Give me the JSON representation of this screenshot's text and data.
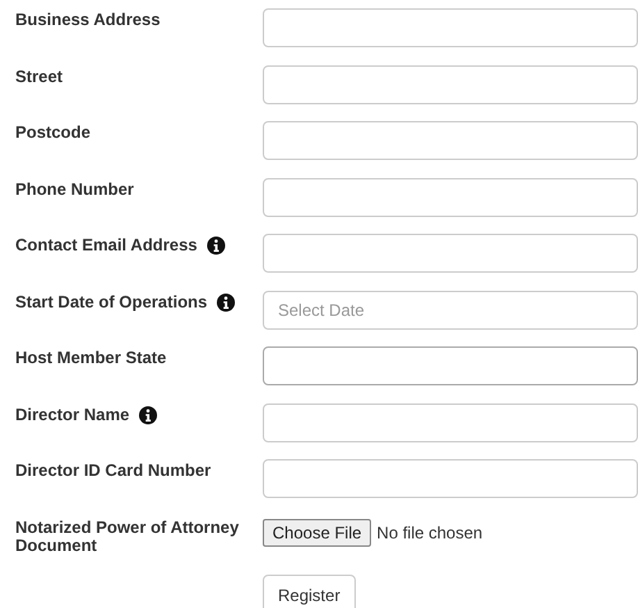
{
  "fields": [
    {
      "label": "Business Address",
      "kind": "text",
      "info": false
    },
    {
      "label": "Street",
      "kind": "text",
      "info": false
    },
    {
      "label": "Postcode",
      "kind": "text",
      "info": false
    },
    {
      "label": "Phone Number",
      "kind": "text",
      "info": false
    },
    {
      "label": "Contact Email Address",
      "kind": "text",
      "info": true
    },
    {
      "label": "Start Date of Operations",
      "kind": "date",
      "info": true,
      "placeholder": "Select Date"
    },
    {
      "label": "Host Member State",
      "kind": "select",
      "info": false
    },
    {
      "label": "Director Name",
      "kind": "text",
      "info": true
    },
    {
      "label": "Director ID Card Number",
      "kind": "text",
      "info": false
    },
    {
      "label": "Notarized Power of Attorney Document",
      "kind": "file",
      "info": false,
      "button": "Choose File",
      "status": "No file chosen"
    }
  ],
  "submit": "Register"
}
